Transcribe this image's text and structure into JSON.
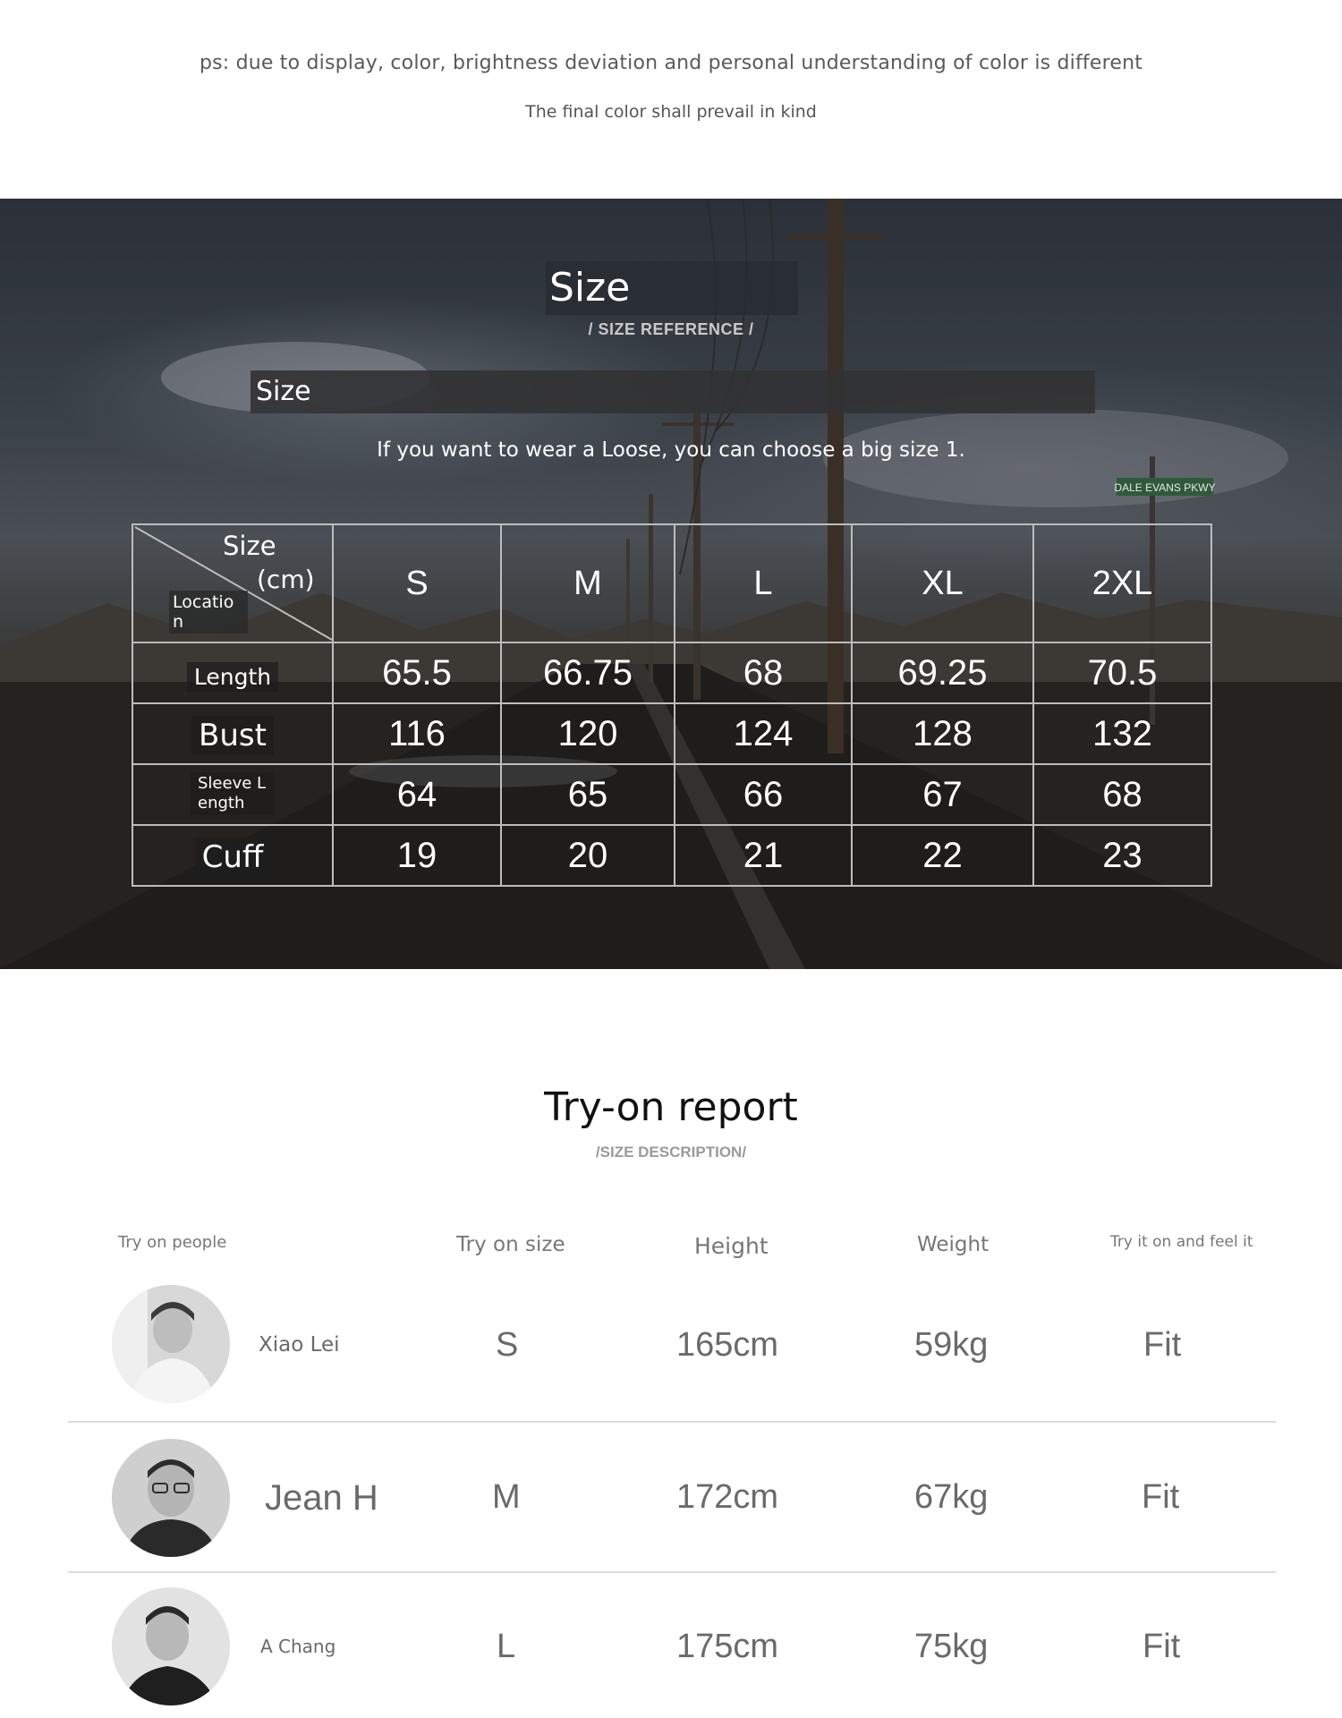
{
  "disclaimer": {
    "line1": "ps: due to display, color, brightness deviation and personal understanding of color is different",
    "line2": "The final color shall prevail in kind"
  },
  "size_section": {
    "title": "Size",
    "subtitle": "/ SIZE REFERENCE /",
    "sub_heading": "Size",
    "advice": "If you want to wear a Loose, you can choose a big size 1.",
    "road_sign": "DALE EVANS PKWY"
  },
  "size_table": {
    "corner": {
      "size": "Size",
      "unit": "(cm)",
      "location": "Location"
    },
    "columns": [
      "S",
      "M",
      "L",
      "XL",
      "2XL"
    ],
    "rows": [
      {
        "label": "Length",
        "values": [
          "65.5",
          "66.75",
          "68",
          "69.25",
          "70.5"
        ]
      },
      {
        "label": "Bust",
        "values": [
          "116",
          "120",
          "124",
          "128",
          "132"
        ]
      },
      {
        "label": "Sleeve Length",
        "values": [
          "64",
          "65",
          "66",
          "67",
          "68"
        ]
      },
      {
        "label": "Cuff",
        "values": [
          "19",
          "20",
          "21",
          "22",
          "23"
        ]
      }
    ]
  },
  "report": {
    "title": "Try-on report",
    "subtitle": "/SIZE DESCRIPTION/",
    "headers": {
      "people": "Try on people",
      "size": "Try on size",
      "height": "Height",
      "weight": "Weight",
      "feel": "Try it on and feel it"
    },
    "rows": [
      {
        "name": "Xiao Lei",
        "size": "S",
        "height": "165cm",
        "weight": "59kg",
        "feel": "Fit"
      },
      {
        "name": "Jean H",
        "size": "M",
        "height": "172cm",
        "weight": "67kg",
        "feel": "Fit"
      },
      {
        "name": "A Chang",
        "size": "L",
        "height": "175cm",
        "weight": "75kg",
        "feel": "Fit"
      }
    ]
  }
}
